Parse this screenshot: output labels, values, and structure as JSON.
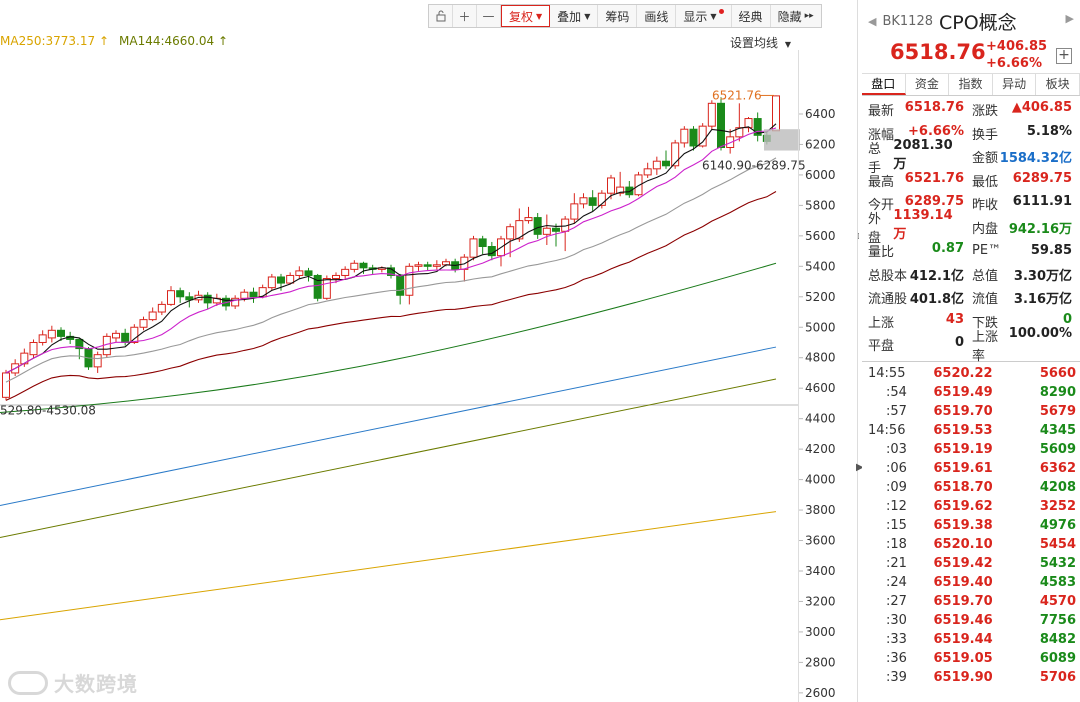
{
  "toolbar": {
    "items": [
      {
        "label": "复权",
        "active": true,
        "caret": true
      },
      {
        "label": "叠加",
        "caret": true
      },
      {
        "label": "筹码"
      },
      {
        "label": "画线"
      },
      {
        "label": "显示",
        "caret": true,
        "dot": true
      },
      {
        "label": "经典"
      },
      {
        "label": "隐藏",
        "suffix": "▸▸"
      }
    ]
  },
  "ma_legend": {
    "ma250": "MA250:3773.17",
    "ma144": "MA144:4660.04"
  },
  "set_ma_label": "设置均线",
  "annotations": {
    "high": "6521.76",
    "range": "6140.90-6289.75",
    "left_range": "529.80-4530.08"
  },
  "watermark": "大数跨境",
  "stock": {
    "code": "BK1128",
    "name": "CPO概念",
    "price": "6518.76",
    "change": "+406.85",
    "change_pct": "+6.66%"
  },
  "tabs": [
    "盘口",
    "资金",
    "指数",
    "异动",
    "板块"
  ],
  "info_rows": [
    [
      {
        "label": "最新",
        "value": "6518.76",
        "cls": "red"
      },
      {
        "label": "涨跌",
        "value": "▲406.85",
        "cls": "red"
      }
    ],
    [
      {
        "label": "涨幅",
        "value": "+6.66%",
        "cls": "red"
      },
      {
        "label": "换手",
        "value": "5.18%",
        "cls": "dark"
      }
    ],
    [
      {
        "label": "总手",
        "value": "2081.30万",
        "cls": "dark"
      },
      {
        "label": "金额",
        "value": "1584.32亿",
        "cls": "blue"
      }
    ],
    [
      {
        "label": "最高",
        "value": "6521.76",
        "cls": "red"
      },
      {
        "label": "最低",
        "value": "6289.75",
        "cls": "red"
      }
    ],
    [
      {
        "label": "今开",
        "value": "6289.75",
        "cls": "red"
      },
      {
        "label": "昨收",
        "value": "6111.91",
        "cls": "dark"
      }
    ],
    [
      {
        "label": "外盘",
        "value": "1139.14万",
        "cls": "red"
      },
      {
        "label": "内盘",
        "value": "942.16万",
        "cls": "green"
      }
    ],
    [
      {
        "label": "量比",
        "value": "0.87",
        "cls": "green"
      },
      {
        "label": "PE™",
        "value": "59.85",
        "cls": "dark"
      }
    ],
    [
      {
        "label": "总股本",
        "value": "412.1亿",
        "cls": "dark"
      },
      {
        "label": "总值",
        "value": "3.30万亿",
        "cls": "dark"
      }
    ],
    [
      {
        "label": "流通股",
        "value": "401.8亿",
        "cls": "dark"
      },
      {
        "label": "流值",
        "value": "3.16万亿",
        "cls": "dark"
      }
    ],
    [
      {
        "label": "上涨",
        "value": "43",
        "cls": "red"
      },
      {
        "label": "下跌",
        "value": "0",
        "cls": "green"
      }
    ],
    [
      {
        "label": "平盘",
        "value": "0",
        "cls": "dark"
      },
      {
        "label": "上涨率",
        "value": "100.00%",
        "cls": "dark"
      }
    ]
  ],
  "ticks": [
    {
      "time": "14:55",
      "price": "6520.22",
      "vol": "5660",
      "dir": "r"
    },
    {
      "time": ":54",
      "price": "6519.49",
      "vol": "8290",
      "dir": "g",
      "sub": true
    },
    {
      "time": ":57",
      "price": "6519.70",
      "vol": "5679",
      "dir": "r",
      "sub": true
    },
    {
      "time": "14:56",
      "price": "6519.53",
      "vol": "4345",
      "dir": "g"
    },
    {
      "time": ":03",
      "price": "6519.19",
      "vol": "5609",
      "dir": "g",
      "sub": true
    },
    {
      "time": ":06",
      "price": "6519.61",
      "vol": "6362",
      "dir": "r",
      "sub": true
    },
    {
      "time": ":09",
      "price": "6518.70",
      "vol": "4208",
      "dir": "g",
      "sub": true
    },
    {
      "time": ":12",
      "price": "6519.62",
      "vol": "3252",
      "dir": "r",
      "sub": true
    },
    {
      "time": ":15",
      "price": "6519.38",
      "vol": "4976",
      "dir": "g",
      "sub": true
    },
    {
      "time": ":18",
      "price": "6520.10",
      "vol": "5454",
      "dir": "r",
      "sub": true
    },
    {
      "time": ":21",
      "price": "6519.42",
      "vol": "5432",
      "dir": "g",
      "sub": true
    },
    {
      "time": ":24",
      "price": "6519.40",
      "vol": "4583",
      "dir": "g",
      "sub": true
    },
    {
      "time": ":27",
      "price": "6519.70",
      "vol": "4570",
      "dir": "r",
      "sub": true
    },
    {
      "time": ":30",
      "price": "6519.46",
      "vol": "7756",
      "dir": "g",
      "sub": true
    },
    {
      "time": ":33",
      "price": "6519.44",
      "vol": "8482",
      "dir": "g",
      "sub": true
    },
    {
      "time": ":36",
      "price": "6519.05",
      "vol": "6089",
      "dir": "g",
      "sub": true
    },
    {
      "time": ":39",
      "price": "6519.90",
      "vol": "5706",
      "dir": "r",
      "sub": true
    }
  ],
  "chart_data": {
    "type": "candlestick",
    "y_ticks": [
      6400,
      6200,
      6000,
      5800,
      5600,
      5400,
      5200,
      5000,
      4800,
      4600,
      4400,
      4200,
      4000,
      3800,
      3600,
      3400,
      3200,
      3000,
      2800,
      2600
    ],
    "ylim": [
      2540,
      6820
    ],
    "colors": {
      "up": "#d9251d",
      "down": "#1a8a1a",
      "ma5": "#111111",
      "ma10": "#cc22cc",
      "ma20": "#999999",
      "ma60": "#8b0000",
      "ma120": "#1a7a1a",
      "ma144": "#6b7b00",
      "ma250": "#d9a400",
      "blue": "#2a7ac8"
    },
    "candles": [
      [
        4540,
        4700,
        4520,
        4720
      ],
      [
        4700,
        4760,
        4680,
        4790
      ],
      [
        4760,
        4830,
        4740,
        4860
      ],
      [
        4820,
        4900,
        4800,
        4920
      ],
      [
        4900,
        4950,
        4880,
        4980
      ],
      [
        4930,
        4980,
        4900,
        5010
      ],
      [
        4980,
        4940,
        4910,
        5000
      ],
      [
        4940,
        4920,
        4890,
        4970
      ],
      [
        4920,
        4860,
        4790,
        4930
      ],
      [
        4860,
        4740,
        4720,
        4870
      ],
      [
        4740,
        4820,
        4700,
        4840
      ],
      [
        4820,
        4940,
        4800,
        4960
      ],
      [
        4930,
        4960,
        4900,
        4980
      ],
      [
        4960,
        4900,
        4880,
        4990
      ],
      [
        4900,
        5000,
        4890,
        5020
      ],
      [
        5000,
        5050,
        4980,
        5070
      ],
      [
        5050,
        5100,
        5040,
        5130
      ],
      [
        5100,
        5150,
        5080,
        5170
      ],
      [
        5150,
        5240,
        5140,
        5270
      ],
      [
        5240,
        5200,
        5160,
        5260
      ],
      [
        5200,
        5180,
        5130,
        5230
      ],
      [
        5180,
        5210,
        5160,
        5240
      ],
      [
        5210,
        5160,
        5120,
        5230
      ],
      [
        5160,
        5190,
        5140,
        5220
      ],
      [
        5190,
        5140,
        5110,
        5210
      ],
      [
        5140,
        5190,
        5120,
        5210
      ],
      [
        5190,
        5230,
        5170,
        5250
      ],
      [
        5230,
        5200,
        5160,
        5260
      ],
      [
        5200,
        5260,
        5190,
        5280
      ],
      [
        5260,
        5330,
        5240,
        5350
      ],
      [
        5330,
        5290,
        5240,
        5350
      ],
      [
        5290,
        5340,
        5280,
        5360
      ],
      [
        5340,
        5370,
        5320,
        5400
      ],
      [
        5370,
        5340,
        5300,
        5390
      ],
      [
        5340,
        5190,
        5170,
        5350
      ],
      [
        5190,
        5320,
        5180,
        5340
      ],
      [
        5320,
        5340,
        5290,
        5360
      ],
      [
        5340,
        5380,
        5320,
        5400
      ],
      [
        5380,
        5420,
        5360,
        5440
      ],
      [
        5420,
        5390,
        5350,
        5430
      ],
      [
        5390,
        5380,
        5350,
        5410
      ],
      [
        5380,
        5390,
        5360,
        5400
      ],
      [
        5390,
        5340,
        5320,
        5410
      ],
      [
        5340,
        5210,
        5150,
        5350
      ],
      [
        5210,
        5400,
        5150,
        5420
      ],
      [
        5400,
        5410,
        5370,
        5430
      ],
      [
        5410,
        5400,
        5370,
        5430
      ],
      [
        5400,
        5410,
        5380,
        5440
      ],
      [
        5410,
        5430,
        5400,
        5450
      ],
      [
        5430,
        5380,
        5360,
        5450
      ],
      [
        5380,
        5460,
        5300,
        5480
      ],
      [
        5460,
        5580,
        5440,
        5600
      ],
      [
        5580,
        5530,
        5480,
        5600
      ],
      [
        5530,
        5470,
        5440,
        5560
      ],
      [
        5470,
        5580,
        5400,
        5600
      ],
      [
        5580,
        5660,
        5460,
        5680
      ],
      [
        5580,
        5700,
        5560,
        5780
      ],
      [
        5700,
        5720,
        5680,
        5790
      ],
      [
        5720,
        5610,
        5580,
        5750
      ],
      [
        5610,
        5650,
        5540,
        5740
      ],
      [
        5650,
        5630,
        5530,
        5680
      ],
      [
        5630,
        5710,
        5500,
        5730
      ],
      [
        5710,
        5810,
        5680,
        5880
      ],
      [
        5810,
        5850,
        5780,
        5880
      ],
      [
        5850,
        5800,
        5760,
        5900
      ],
      [
        5800,
        5880,
        5780,
        5900
      ],
      [
        5880,
        5980,
        5840,
        6000
      ],
      [
        5880,
        5920,
        5860,
        6020
      ],
      [
        5920,
        5870,
        5850,
        5960
      ],
      [
        5870,
        6000,
        5860,
        6020
      ],
      [
        6000,
        6040,
        5980,
        6080
      ],
      [
        6040,
        6090,
        6000,
        6120
      ],
      [
        6090,
        6060,
        6040,
        6160
      ],
      [
        6060,
        6210,
        6040,
        6230
      ],
      [
        6210,
        6300,
        6180,
        6320
      ],
      [
        6300,
        6190,
        6160,
        6320
      ],
      [
        6190,
        6320,
        6180,
        6340
      ],
      [
        6320,
        6470,
        6300,
        6490
      ],
      [
        6470,
        6180,
        6160,
        6510
      ],
      [
        6180,
        6250,
        6140,
        6300
      ],
      [
        6250,
        6310,
        6220,
        6470
      ],
      [
        6310,
        6370,
        6280,
        6380
      ],
      [
        6370,
        6260,
        6220,
        6410
      ],
      [
        6260,
        6220,
        6200,
        6290
      ],
      [
        6289.75,
        6518.76,
        6289.75,
        6521.76
      ]
    ],
    "ma5_end": 6270,
    "ma250_value": 3773.17,
    "ma144_value": 4660.04
  }
}
